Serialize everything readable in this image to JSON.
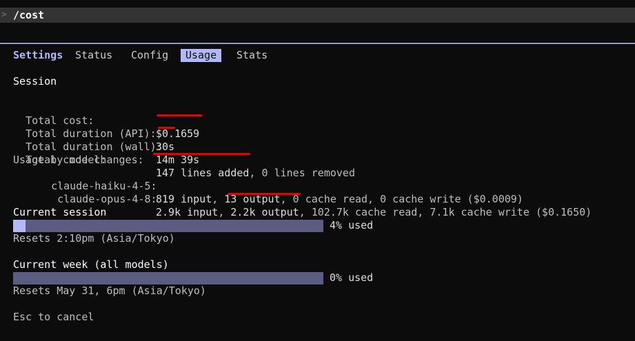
{
  "prompt": {
    "caret": ">",
    "command": "/cost"
  },
  "tabs": [
    {
      "label": "Settings",
      "brand": true
    },
    {
      "label": "Status"
    },
    {
      "label": "Config"
    },
    {
      "label": "Usage",
      "active": true
    },
    {
      "label": "Stats"
    }
  ],
  "session": {
    "heading": "Session",
    "total_cost_label": "Total cost:",
    "total_cost_value": "$0.1659",
    "duration_api_label": "Total duration (API):",
    "duration_api_value": "30s",
    "duration_wall_label": "Total duration (wall):",
    "duration_wall_value": "14m 39s",
    "code_changes_label": "Total code changes:",
    "code_changes_added": "147 lines added",
    "code_changes_removed": ", 0 lines removed",
    "usage_by_model_label": "Usage by model:",
    "models": [
      {
        "name": "claude-haiku-4-5:",
        "input": "819 input",
        "output": "13 output",
        "rest": ", 0 cache read, 0 cache write ($0.0009)"
      },
      {
        "name": "claude-opus-4-8:",
        "input": "2.9k input",
        "output": "2.2k output",
        "rest": ", 102.7k cache read, 7.1k cache write ($0.1650)"
      }
    ]
  },
  "current_session": {
    "heading": "Current session",
    "percent": 4,
    "used_label": "4% used",
    "resets": "Resets 2:10pm (Asia/Tokyo)"
  },
  "current_week": {
    "heading": "Current week (all models)",
    "percent": 0,
    "used_label": "0% used",
    "resets": "Resets May 31, 6pm (Asia/Tokyo)"
  },
  "footer": {
    "hint": "Esc to cancel"
  },
  "colors": {
    "accent": "#b1b9f9",
    "bar_track": "#5c5c80",
    "annotation_red": "#e60000"
  }
}
